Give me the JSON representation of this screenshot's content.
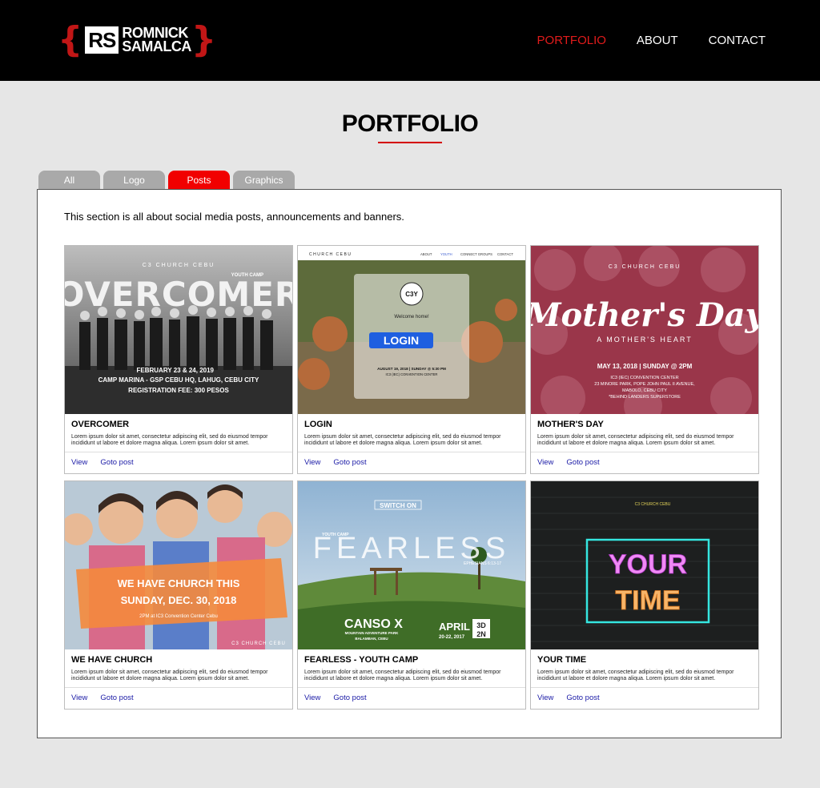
{
  "header": {
    "logo_initials": "RS",
    "logo_line1": "ROMNICK",
    "logo_line2": "SAMALCA",
    "nav": [
      {
        "label": "PORTFOLIO",
        "active": true
      },
      {
        "label": "ABOUT",
        "active": false
      },
      {
        "label": "CONTACT",
        "active": false
      }
    ]
  },
  "page": {
    "title": "PORTFOLIO",
    "tabs": [
      "All",
      "Logo",
      "Posts",
      "Graphics"
    ],
    "active_tab": "Posts",
    "intro": "This section is all about social media posts, announcements and banners."
  },
  "colors": {
    "accent": "#e11b1b",
    "tab_active": "#f10000",
    "tab_inactive": "#a9a9a9",
    "link": "#1a1aa6"
  },
  "cards": [
    {
      "title": "OVERCOMER",
      "desc": "Lorem ipsum dolor sit amet, consectetur adipiscing elit, sed do eiusmod tempor incididunt ut labore et dolore magna aliqua. Lorem ipsum dolor sit amet.",
      "view": "View",
      "goto": "Goto post",
      "image_text": {
        "brand": "C3 CHURCH CEBU",
        "tag": "YOUTH CAMP",
        "headline": "OVERCOMER",
        "date": "FEBRUARY 23 & 24, 2019",
        "venue": "CAMP MARINA - GSP CEBU HQ, LAHUG, CEBU CITY",
        "fee": "REGISTRATION FEE: 300 PESOS"
      }
    },
    {
      "title": "LOGIN",
      "desc": "Lorem ipsum dolor sit amet, consectetur adipiscing elit, sed do eiusmod tempor incididunt ut labore et dolore magna aliqua. Lorem ipsum dolor sit amet.",
      "view": "View",
      "goto": "Goto post",
      "image_text": {
        "brand": "CHURCH CEBU",
        "menu": [
          "ABOUT",
          "YOUTH",
          "CONNECT GROUPS",
          "CONTACT"
        ],
        "badge": "C3Y",
        "welcome": "Welcome home!",
        "button": "LOGIN",
        "date": "AUGUST 19, 2018 | SUNDAY @ 5:30 PM",
        "venue": "IC3 (IEC) CONVENTION CENTER"
      }
    },
    {
      "title": "MOTHER'S DAY",
      "desc": "Lorem ipsum dolor sit amet, consectetur adipiscing elit, sed do eiusmod tempor incididunt ut labore et dolore magna aliqua. Lorem ipsum dolor sit amet.",
      "view": "View",
      "goto": "Goto post",
      "image_text": {
        "brand": "C3 CHURCH CEBU",
        "headline": "Mother's Day",
        "sub": "A MOTHER'S HEART",
        "date": "MAY 13, 2018 | SUNDAY @ 2PM",
        "l1": "IC3 (IEC) CONVENTION CENTER",
        "l2": "23 MINORE PARK, POPE JOHN PAUL II AVENUE,",
        "l3": "MABOLO, CEBU CITY",
        "l4": "*BEHIND LANDERS SUPERSTORE"
      }
    },
    {
      "title": "WE HAVE CHURCH",
      "desc": "Lorem ipsum dolor sit amet, consectetur adipiscing elit, sed do eiusmod tempor incididunt ut labore et dolore magna aliqua. Lorem ipsum dolor sit amet.",
      "view": "View",
      "goto": "Goto post",
      "image_text": {
        "l1": "WE HAVE CHURCH THIS",
        "l2": "SUNDAY, DEC. 30, 2018",
        "l3": "2PM at IC3 Convention Center Cebu",
        "brand": "C3 CHURCH CEBU"
      }
    },
    {
      "title": "FEARLESS - YOUTH CAMP",
      "desc": "Lorem ipsum dolor sit amet, consectetur adipiscing elit, sed do eiusmod tempor incididunt ut labore et dolore magna aliqua. Lorem ipsum dolor sit amet.",
      "view": "View",
      "goto": "Goto post",
      "image_text": {
        "switch": "SWITCH ON",
        "tag": "YOUTH CAMP",
        "headline": "FEARLESS",
        "verse": "EPHESIANS 6:13-17",
        "place": "CANSO X",
        "place_sub": "MOUNTAIN ADVENTURE PARK",
        "place_sub2": "BALAMBAN, CEBU",
        "month": "APRIL",
        "days": "20-22, 2017",
        "dn1": "3D",
        "dn2": "2N"
      }
    },
    {
      "title": "YOUR TIME",
      "desc": "Lorem ipsum dolor sit amet, consectetur adipiscing elit, sed do eiusmod tempor incididunt ut labore et dolore magna aliqua. Lorem ipsum dolor sit amet.",
      "view": "View",
      "goto": "Goto post",
      "image_text": {
        "brand": "C3 CHURCH CEBU",
        "l1": "YOUR",
        "l2": "TIME"
      }
    }
  ]
}
